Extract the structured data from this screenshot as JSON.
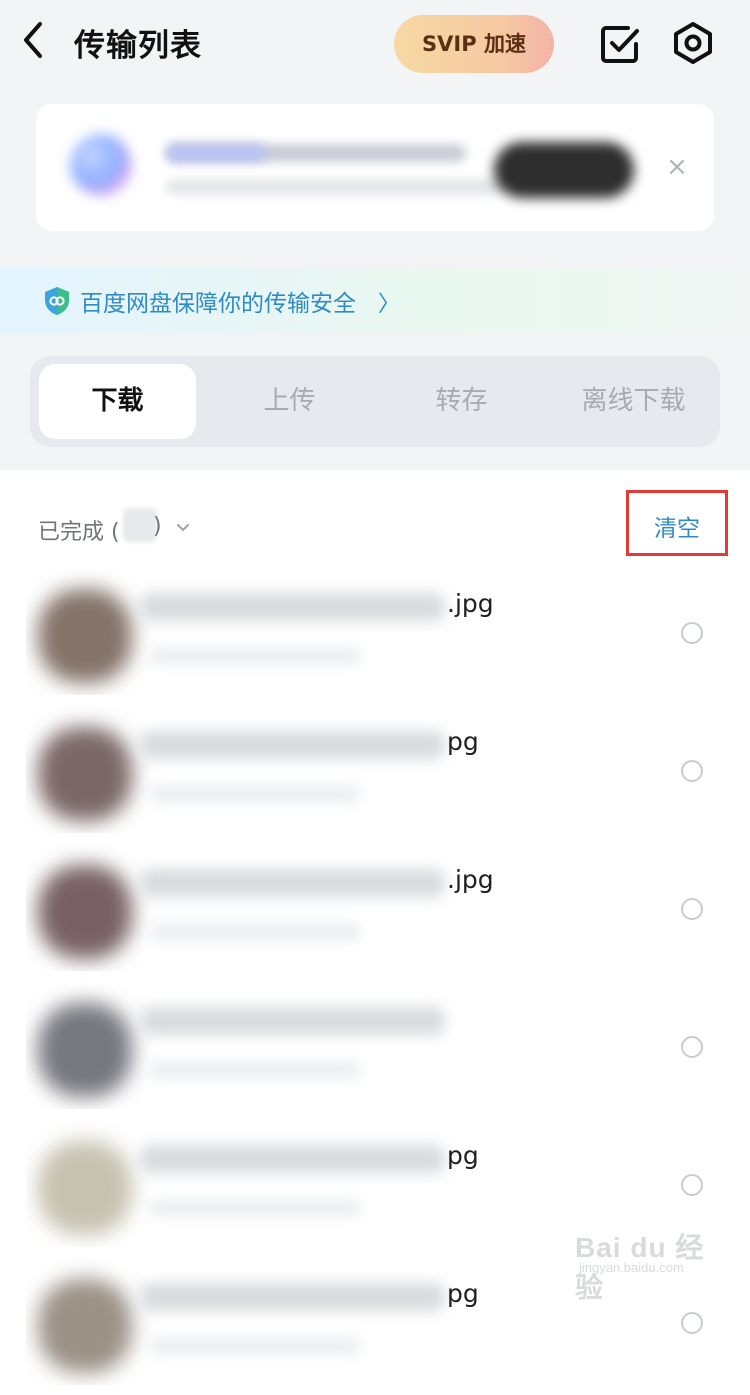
{
  "header": {
    "title": "传输列表",
    "svip_label": "SVIP 加速"
  },
  "security": {
    "text": "百度网盘保障你的传输安全",
    "chevron": "〉"
  },
  "banner": {
    "close_label": "×"
  },
  "tabs": [
    {
      "label": "下载",
      "active": true
    },
    {
      "label": "上传",
      "active": false
    },
    {
      "label": "转存",
      "active": false
    },
    {
      "label": "离线下载",
      "active": false
    }
  ],
  "section": {
    "label": "已完成 (",
    "paren_close": ")",
    "clear_label": "清空"
  },
  "files": [
    {
      "name_tail": ".jpg",
      "thumb_color": "#5b4436"
    },
    {
      "name_tail": "pg",
      "thumb_color": "#4f3534"
    },
    {
      "name_tail": ".jpg",
      "thumb_color": "#4a2c33"
    },
    {
      "name_tail": "",
      "thumb_color": "#4a4a55"
    },
    {
      "name_tail": "pg",
      "thumb_color": "#b4ae96"
    },
    {
      "name_tail": "pg",
      "thumb_color": "#7a6d5f"
    }
  ],
  "watermark": {
    "logo": "Bai du 经验",
    "url": "jingyan.baidu.com"
  },
  "colors": {
    "accent_blue": "#2f8bc7",
    "highlight_red": "#e53935",
    "svip_text": "#5b2f12"
  }
}
